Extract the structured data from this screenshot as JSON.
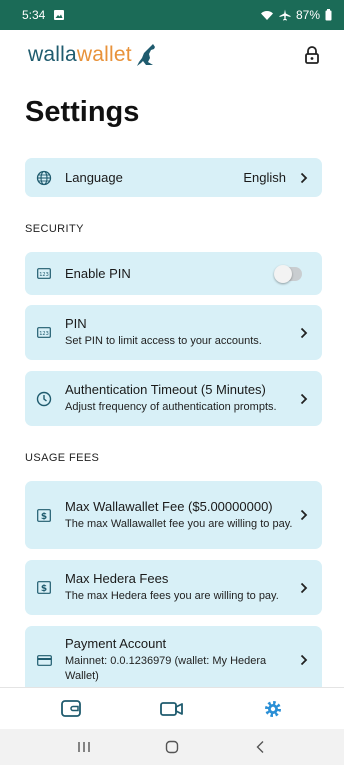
{
  "status_bar": {
    "time": "5:34",
    "battery": "87%"
  },
  "header": {
    "logo_part1": "walla",
    "logo_part2": "wallet"
  },
  "page": {
    "title": "Settings"
  },
  "language": {
    "label": "Language",
    "value": "English"
  },
  "security": {
    "heading": "SECURITY",
    "enable_pin": {
      "title": "Enable PIN",
      "enabled": false
    },
    "pin": {
      "title": "PIN",
      "subtitle": "Set PIN to limit access to your accounts."
    },
    "auth_timeout": {
      "title": "Authentication Timeout (5 Minutes)",
      "subtitle": "Adjust frequency of authentication prompts."
    }
  },
  "usage_fees": {
    "heading": "USAGE FEES",
    "max_wallawallet_fee": {
      "title": "Max Wallawallet Fee ($5.00000000)",
      "subtitle": "The max Wallawallet fee you are willing to pay."
    },
    "max_hedera_fees": {
      "title": "Max Hedera Fees",
      "subtitle": "The max Hedera fees you are willing to pay."
    },
    "payment_account": {
      "title": "Payment Account",
      "subtitle": "Mainnet: 0.0.1236979 (wallet: My Hedera Wallet)"
    }
  },
  "icons": {
    "globe": "globe-icon",
    "pin_pad": "pin-pad-icon",
    "clock": "clock-icon",
    "dollar": "dollar-icon",
    "card": "credit-card-icon",
    "wallet_nav": "wallet-icon",
    "video_nav": "video-icon",
    "settings_nav": "settings-gear-icon"
  },
  "colors": {
    "status_bar": "#1b6b57",
    "card_bg": "#d8f0f7",
    "logo_blue": "#1f5b6e",
    "logo_orange": "#e8923a",
    "active_nav": "#2a8fd6",
    "icon_teal": "#1f5b6e"
  }
}
